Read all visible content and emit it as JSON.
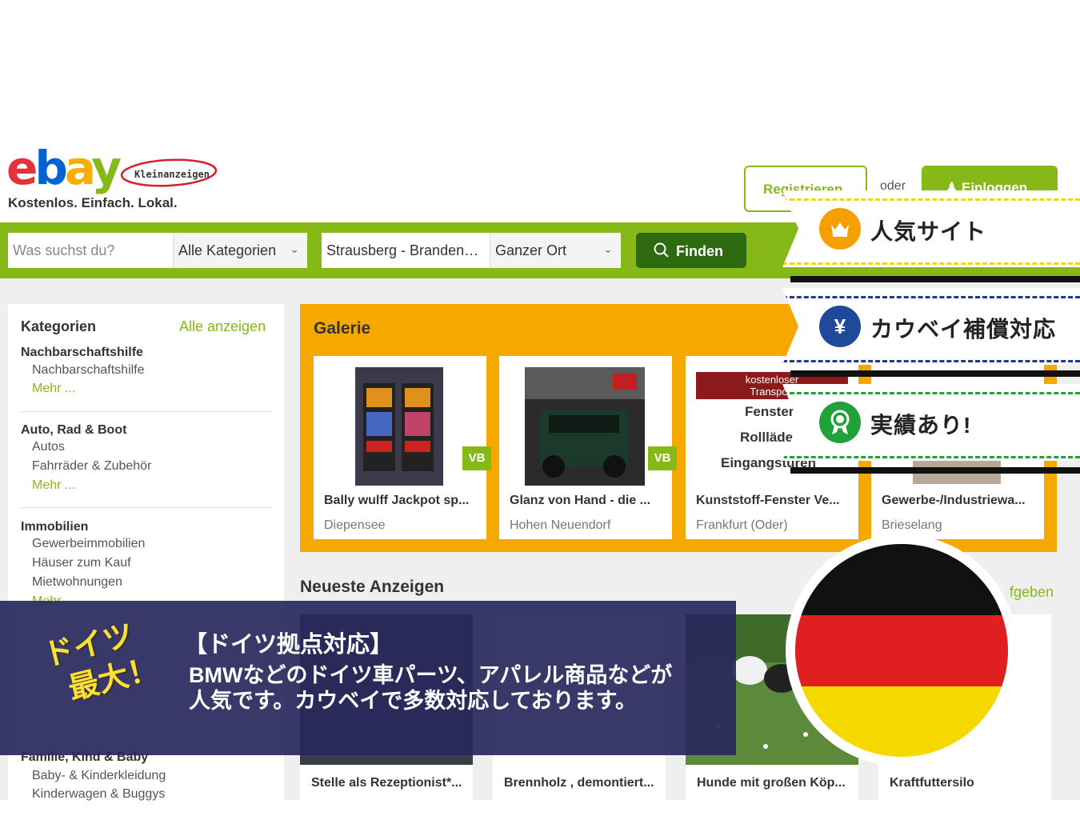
{
  "header": {
    "logo_letters": [
      "e",
      "b",
      "a",
      "y"
    ],
    "logo_colors": [
      "#e53238",
      "#0064d2",
      "#f5af02",
      "#86b817"
    ],
    "sublogo": "Kleinanzeigen",
    "tagline": "Kostenlos. Einfach. Lokal.",
    "register_label": "Registrieren",
    "or_label": "oder",
    "login_label": "Einloggen"
  },
  "search": {
    "placeholder": "Was suchst du?",
    "category": "Alle Kategorien",
    "location": "Strausberg - Brandenburg",
    "radius": "Ganzer Ort",
    "find_label": "Finden"
  },
  "sidebar": {
    "title": "Kategorien",
    "show_all": "Alle anzeigen",
    "sections": [
      {
        "name": "Nachbarschaftshilfe",
        "items": [
          "Nachbarschaftshilfe"
        ],
        "more": "Mehr ..."
      },
      {
        "name": "Auto, Rad & Boot",
        "items": [
          "Autos",
          "Fahrräder & Zubehör"
        ],
        "more": "Mehr ..."
      },
      {
        "name": "Immobilien",
        "items": [
          "Gewerbeimmobilien",
          "Häuser zum Kauf",
          "Mietwohnungen"
        ],
        "more": "Mehr ..."
      },
      {
        "name": "Familie, Kind & Baby",
        "items": [
          "Baby- & Kinderkleidung",
          "Kinderwagen & Buggys"
        ]
      }
    ]
  },
  "gallery": {
    "title": "Galerie",
    "cards": [
      {
        "title": "Bally wulff Jackpot sp...",
        "location": "Diepensee",
        "badge": "VB"
      },
      {
        "title": "Glanz von Hand - die ...",
        "location": "Hohen Neuendorf",
        "badge": "VB"
      },
      {
        "title": "Kunststoff-Fenster Ve...",
        "location": "Frankfurt (Oder)",
        "ad_lines": [
          "kostenloser",
          "Transport",
          "Fenster",
          "Rollläden",
          "Eingangstüren"
        ]
      },
      {
        "title": "Gewerbe-/Industriewa...",
        "location": "Brieselang"
      }
    ]
  },
  "newest": {
    "title": "Neueste Anzeigen",
    "post_link": "fgeben",
    "cards": [
      {
        "title": "Stelle als Rezeptionist*..."
      },
      {
        "title": "Brennholz , demontiert..."
      },
      {
        "title": "Hunde mit großen Köp..."
      },
      {
        "title": "Kraftfuttersilo"
      }
    ]
  },
  "banner": {
    "title": "【ドイツ拠点対応】",
    "line1": "BMWなどのドイツ車パーツ、アパレル商品などが",
    "line2": "人気です。カウベイで多数対応しております。",
    "accent1": "ドイツ",
    "accent2": "最大！"
  },
  "badges": [
    {
      "label": "人気サイト",
      "icon": "crown-icon",
      "color": "#f5a000"
    },
    {
      "label": "カウベイ補償対応",
      "icon": "yen-icon",
      "color": "#1f4a9a"
    },
    {
      "label": "実績あり!",
      "icon": "award-ribbon-icon",
      "color": "#22a03a"
    }
  ],
  "flag": {
    "colors": [
      "#111111",
      "#e02020",
      "#f5d800"
    ]
  }
}
